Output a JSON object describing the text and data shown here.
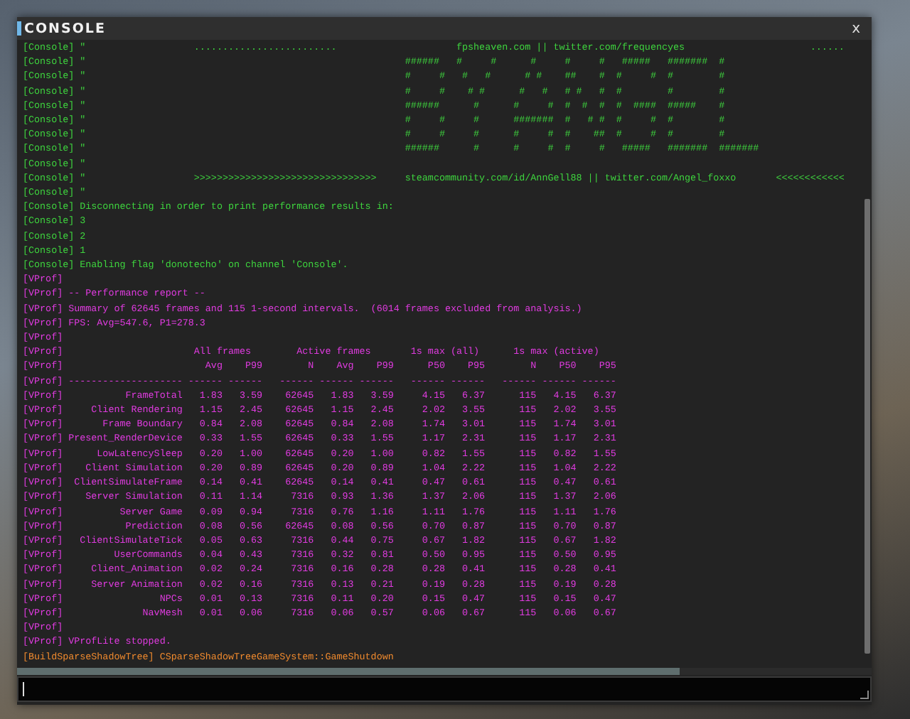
{
  "window": {
    "title": "CONSOLE",
    "close": "x"
  },
  "lines": [
    {
      "kind": "text",
      "color": "#3ed43e",
      "text": "[Console] \"                   .........................                     fpsheaven.com || twitter.com/frequencyes                      ......"
    },
    {
      "kind": "art",
      "color": "#3ed43e",
      "prefix": "[Console] \"",
      "art": "######   #     #      #     #     #   #####   #######  #"
    },
    {
      "kind": "art",
      "color": "#3ed43e",
      "prefix": "[Console] \"",
      "art": "#     #   #   #      # #    ##    #  #     #  #        #"
    },
    {
      "kind": "art",
      "color": "#3ed43e",
      "prefix": "[Console] \"",
      "art": "#     #    # #      #   #   # #   #  #        #        #"
    },
    {
      "kind": "art",
      "color": "#3ed43e",
      "prefix": "[Console] \"",
      "art": "######      #      #     #  #  #  #  #  ####  #####    #"
    },
    {
      "kind": "art",
      "color": "#3ed43e",
      "prefix": "[Console] \"",
      "art": "#     #     #      #######  #   # #  #     #  #        #"
    },
    {
      "kind": "art",
      "color": "#3ed43e",
      "prefix": "[Console] \"",
      "art": "#     #     #      #     #  #    ##  #     #  #        #"
    },
    {
      "kind": "art",
      "color": "#3ed43e",
      "prefix": "[Console] \"",
      "art": "######      #      #     #  #     #   #####   #######  #######"
    },
    {
      "kind": "text",
      "color": "#3ed43e",
      "text": "[Console] \""
    },
    {
      "kind": "text",
      "color": "#3ed43e",
      "text": "[Console] \"                   >>>>>>>>>>>>>>>>>>>>>>>>>>>>>>>>     steamcommunity.com/id/AnnGell88 || twitter.com/Angel_foxxo       <<<<<<<<<<<<"
    },
    {
      "kind": "text",
      "color": "#3ed43e",
      "text": "[Console] \""
    },
    {
      "kind": "text",
      "color": "#3ed43e",
      "text": "[Console] Disconnecting in order to print performance results in:"
    },
    {
      "kind": "text",
      "color": "#3ed43e",
      "text": "[Console] 3"
    },
    {
      "kind": "text",
      "color": "#3ed43e",
      "text": "[Console] 2"
    },
    {
      "kind": "text",
      "color": "#3ed43e",
      "text": "[Console] 1"
    },
    {
      "kind": "text",
      "color": "#3ed43e",
      "text": "[Console] Enabling flag 'donotecho' on channel 'Console'."
    },
    {
      "kind": "text",
      "color": "#e03be0",
      "text": "[VProf]"
    },
    {
      "kind": "text",
      "color": "#e03be0",
      "text": "[VProf] -- Performance report --"
    },
    {
      "kind": "text",
      "color": "#e03be0",
      "text": "[VProf] Summary of 62645 frames and 115 1-second intervals.  (6014 frames excluded from analysis.)"
    },
    {
      "kind": "text",
      "color": "#e03be0",
      "text": "[VProf] FPS: Avg=547.6, P1=278.3"
    },
    {
      "kind": "text",
      "color": "#e03be0",
      "text": "[VProf]"
    },
    {
      "kind": "groups",
      "color": "#e03be0",
      "tag": "[VProf]",
      "cells": [
        "All frames",
        "Active frames",
        "1s max (all)",
        "1s max (active)"
      ]
    },
    {
      "kind": "header",
      "color": "#e03be0",
      "tag": "[VProf]",
      "cells": [
        "Avg",
        "P99",
        "N",
        "Avg",
        "P99",
        "P50",
        "P95",
        "N",
        "P50",
        "P95"
      ]
    },
    {
      "kind": "row",
      "color": "#e03be0",
      "tag": "[VProf]",
      "cells": [
        "--------------------",
        "------",
        "------",
        "------",
        "------",
        "------",
        "------",
        "------",
        "------",
        "------",
        "------"
      ]
    },
    {
      "kind": "row",
      "color": "#e03be0",
      "tag": "[VProf]",
      "cells": [
        "FrameTotal",
        "1.83",
        "3.59",
        "62645",
        "1.83",
        "3.59",
        "4.15",
        "6.37",
        "115",
        "4.15",
        "6.37"
      ]
    },
    {
      "kind": "row",
      "color": "#e03be0",
      "tag": "[VProf]",
      "cells": [
        "Client Rendering",
        "1.15",
        "2.45",
        "62645",
        "1.15",
        "2.45",
        "2.02",
        "3.55",
        "115",
        "2.02",
        "3.55"
      ]
    },
    {
      "kind": "row",
      "color": "#e03be0",
      "tag": "[VProf]",
      "cells": [
        "Frame Boundary",
        "0.84",
        "2.08",
        "62645",
        "0.84",
        "2.08",
        "1.74",
        "3.01",
        "115",
        "1.74",
        "3.01"
      ]
    },
    {
      "kind": "row",
      "color": "#e03be0",
      "tag": "[VProf]",
      "cells": [
        "Present_RenderDevice",
        "0.33",
        "1.55",
        "62645",
        "0.33",
        "1.55",
        "1.17",
        "2.31",
        "115",
        "1.17",
        "2.31"
      ]
    },
    {
      "kind": "row",
      "color": "#e03be0",
      "tag": "[VProf]",
      "cells": [
        "LowLatencySleep",
        "0.20",
        "1.00",
        "62645",
        "0.20",
        "1.00",
        "0.82",
        "1.55",
        "115",
        "0.82",
        "1.55"
      ]
    },
    {
      "kind": "row",
      "color": "#e03be0",
      "tag": "[VProf]",
      "cells": [
        "Client Simulation",
        "0.20",
        "0.89",
        "62645",
        "0.20",
        "0.89",
        "1.04",
        "2.22",
        "115",
        "1.04",
        "2.22"
      ]
    },
    {
      "kind": "row",
      "color": "#e03be0",
      "tag": "[VProf]",
      "cells": [
        "ClientSimulateFrame",
        "0.14",
        "0.41",
        "62645",
        "0.14",
        "0.41",
        "0.47",
        "0.61",
        "115",
        "0.47",
        "0.61"
      ]
    },
    {
      "kind": "row",
      "color": "#e03be0",
      "tag": "[VProf]",
      "cells": [
        "Server Simulation",
        "0.11",
        "1.14",
        "7316",
        "0.93",
        "1.36",
        "1.37",
        "2.06",
        "115",
        "1.37",
        "2.06"
      ]
    },
    {
      "kind": "row",
      "color": "#e03be0",
      "tag": "[VProf]",
      "cells": [
        "Server Game",
        "0.09",
        "0.94",
        "7316",
        "0.76",
        "1.16",
        "1.11",
        "1.76",
        "115",
        "1.11",
        "1.76"
      ]
    },
    {
      "kind": "row",
      "color": "#e03be0",
      "tag": "[VProf]",
      "cells": [
        "Prediction",
        "0.08",
        "0.56",
        "62645",
        "0.08",
        "0.56",
        "0.70",
        "0.87",
        "115",
        "0.70",
        "0.87"
      ]
    },
    {
      "kind": "row",
      "color": "#e03be0",
      "tag": "[VProf]",
      "cells": [
        "ClientSimulateTick",
        "0.05",
        "0.63",
        "7316",
        "0.44",
        "0.75",
        "0.67",
        "1.82",
        "115",
        "0.67",
        "1.82"
      ]
    },
    {
      "kind": "row",
      "color": "#e03be0",
      "tag": "[VProf]",
      "cells": [
        "UserCommands",
        "0.04",
        "0.43",
        "7316",
        "0.32",
        "0.81",
        "0.50",
        "0.95",
        "115",
        "0.50",
        "0.95"
      ]
    },
    {
      "kind": "row",
      "color": "#e03be0",
      "tag": "[VProf]",
      "cells": [
        "Client_Animation",
        "0.02",
        "0.24",
        "7316",
        "0.16",
        "0.28",
        "0.28",
        "0.41",
        "115",
        "0.28",
        "0.41"
      ]
    },
    {
      "kind": "row",
      "color": "#e03be0",
      "tag": "[VProf]",
      "cells": [
        "Server Animation",
        "0.02",
        "0.16",
        "7316",
        "0.13",
        "0.21",
        "0.19",
        "0.28",
        "115",
        "0.19",
        "0.28"
      ]
    },
    {
      "kind": "row",
      "color": "#e03be0",
      "tag": "[VProf]",
      "cells": [
        "NPCs",
        "0.01",
        "0.13",
        "7316",
        "0.11",
        "0.20",
        "0.15",
        "0.47",
        "115",
        "0.15",
        "0.47"
      ]
    },
    {
      "kind": "row",
      "color": "#e03be0",
      "tag": "[VProf]",
      "cells": [
        "NavMesh",
        "0.01",
        "0.06",
        "7316",
        "0.06",
        "0.57",
        "0.06",
        "0.67",
        "115",
        "0.06",
        "0.67"
      ]
    },
    {
      "kind": "text",
      "color": "#e03be0",
      "text": "[VProf]"
    },
    {
      "kind": "text",
      "color": "#e03be0",
      "text": "[VProf] VProfLite stopped."
    },
    {
      "kind": "text",
      "color": "#f08a2e",
      "text": "[BuildSparseShadowTree] CSparseShadowTreeGameSystem::GameShutdown"
    }
  ]
}
